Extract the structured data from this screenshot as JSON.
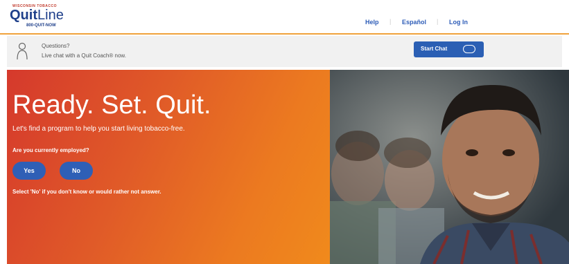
{
  "header": {
    "logo": {
      "tagline": "WISCONSIN TOBACCO",
      "brand_quit": "Quit",
      "brand_line": "Line",
      "phone": "800-QUIT-NOW"
    },
    "nav": {
      "help": "Help",
      "espanol": "Español",
      "login": "Log In"
    },
    "accent_color": "#f0a23b"
  },
  "chatbar": {
    "title": "Questions?",
    "subtitle": "Live chat with a Quit Coach® now.",
    "start_chat_label": "Start Chat",
    "button_color": "#2b5fb4"
  },
  "hero": {
    "title": "Ready. Set. Quit.",
    "subtitle": "Let's find a program to help you start living tobacco-free.",
    "question": "Are you currently employed?",
    "yes_label": "Yes",
    "no_label": "No",
    "note": "Select 'No' if you don't know or would rather not answer.",
    "gradient_colors": [
      "#d5392c",
      "#f08a1c"
    ],
    "photo": "smiling-man-photo"
  }
}
